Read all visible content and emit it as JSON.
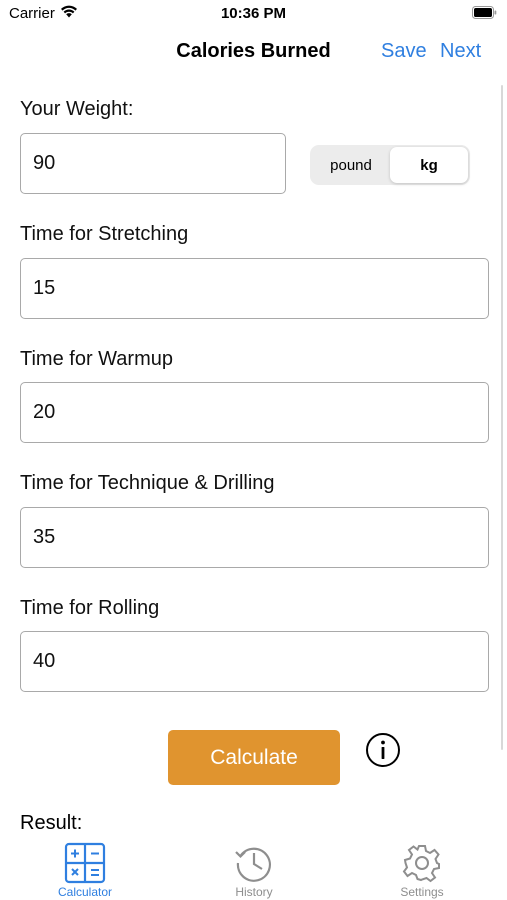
{
  "status_bar": {
    "carrier": "Carrier",
    "time": "10:36 PM",
    "icons": [
      "wifi-icon",
      "battery-icon"
    ]
  },
  "nav": {
    "title": "Calories Burned",
    "save_label": "Save",
    "next_label": "Next"
  },
  "weight": {
    "label": "Your Weight:",
    "value": "90",
    "units": [
      "pound",
      "kg"
    ],
    "selected_unit": "kg"
  },
  "fields": [
    {
      "label": "Time for Stretching",
      "value": "15"
    },
    {
      "label": "Time for Warmup",
      "value": "20"
    },
    {
      "label": "Time for Technique & Drilling",
      "value": "35"
    },
    {
      "label": "Time for Rolling",
      "value": "40"
    }
  ],
  "actions": {
    "calculate_label": "Calculate",
    "info_icon": "info-icon"
  },
  "result": {
    "label": "Result:"
  },
  "tab_bar": {
    "tabs": [
      {
        "label": "Calculator",
        "icon": "calculator-icon",
        "active": true
      },
      {
        "label": "History",
        "icon": "history-icon",
        "active": false
      },
      {
        "label": "Settings",
        "icon": "settings-gear-icon",
        "active": false
      }
    ]
  },
  "colors": {
    "accent": "#2f7fe0",
    "calculate_button": "#e0942f",
    "inactive_tab": "#8e8e8e"
  }
}
